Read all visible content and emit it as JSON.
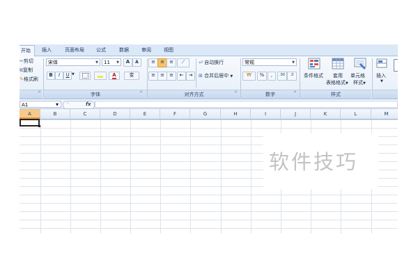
{
  "tabs": [
    "开始",
    "插入",
    "页面布局",
    "公式",
    "数据",
    "审阅",
    "视图"
  ],
  "clipboard": {
    "cut": "剪切",
    "copy": "复制",
    "format_painter": "格式刷"
  },
  "font": {
    "name": "宋体",
    "size": "11",
    "bold": "B",
    "italic": "I",
    "underline": "U",
    "grow": "A",
    "shrink": "A",
    "color_a": "A",
    "phonetic": "变"
  },
  "alignment": {
    "wrap_text": "自动换行",
    "merge_center": "合并后居中"
  },
  "number": {
    "format": "常规",
    "percent": "%",
    "comma": ","
  },
  "styles": {
    "conditional_format": "条件格式",
    "table_format_1": "套用",
    "table_format_2": "表格格式",
    "cell_styles_1": "单元格",
    "cell_styles_2": "样式"
  },
  "cells": {
    "insert": "插入"
  },
  "group_labels": {
    "font": "字体",
    "alignment": "对齐方式",
    "number": "数字",
    "styles": "样式"
  },
  "formula_bar": {
    "name_box": "A1",
    "fx": "fx"
  },
  "columns": [
    "A",
    "B",
    "C",
    "D",
    "E",
    "F",
    "G",
    "H",
    "I",
    "J",
    "K",
    "L",
    "M"
  ],
  "watermark": "软件技巧",
  "colors": {
    "ribbon_bg": "#e6eef8",
    "tab_bar": "#dbe8f7",
    "active_col": "#f7c98a",
    "grid_line": "#dde3ea",
    "watermark": "#c3c3c3"
  }
}
